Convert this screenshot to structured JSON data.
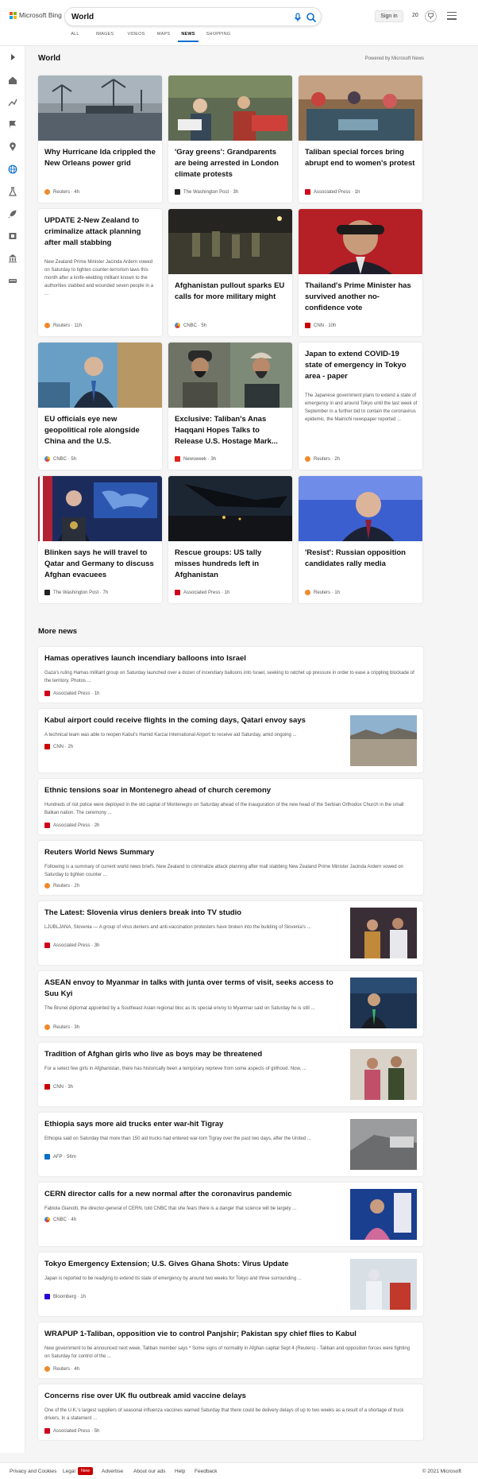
{
  "header": {
    "logo_text": "Microsoft Bing",
    "search_value": "World",
    "signin_label": "Sign in",
    "rewards_count": "20"
  },
  "tabs": [
    {
      "label": "ALL"
    },
    {
      "label": "IMAGES"
    },
    {
      "label": "VIDEOS"
    },
    {
      "label": "MAPS"
    },
    {
      "label": "NEWS"
    },
    {
      "label": "SHOPPING"
    }
  ],
  "page": {
    "title": "World",
    "powered_by": "Powered by Microsoft News",
    "more_news": "More news"
  },
  "cards": [
    {
      "title": "Why Hurricane Ida crippled the New Orleans power grid",
      "source": "Reuters",
      "age": "4h",
      "snippet": ""
    },
    {
      "title": "'Gray greens': Grandparents are being arrested in London climate protests",
      "source": "The Washington Post",
      "age": "3h",
      "snippet": ""
    },
    {
      "title": "Taliban special forces bring abrupt end to women's protest",
      "source": "Associated Press",
      "age": "1h",
      "snippet": ""
    },
    {
      "title": "UPDATE 2-New Zealand to criminalize attack planning after mall stabbing",
      "source": "Reuters",
      "age": "11h",
      "snippet": "New Zealand Prime Minister Jacinda Ardern vowed on Saturday to tighten counter-terrorism laws this month after a knife-wielding militant known to the authorities stabbed and wounded seven people in a ..."
    },
    {
      "title": "Afghanistan pullout sparks EU calls for more military might",
      "source": "CNBC",
      "age": "5h",
      "snippet": ""
    },
    {
      "title": "Thailand's Prime Minister has survived another no-confidence vote",
      "source": "CNN",
      "age": "10h",
      "snippet": ""
    },
    {
      "title": "EU officials eye new geopolitical role alongside China and the U.S.",
      "source": "CNBC",
      "age": "5h",
      "snippet": ""
    },
    {
      "title": "Exclusive: Taliban's Anas Haqqani Hopes Talks to Release U.S. Hostage Mark...",
      "source": "Newsweek",
      "age": "3h",
      "snippet": ""
    },
    {
      "title": "Japan to extend COVID-19 state of emergency in Tokyo area - paper",
      "source": "Reuters",
      "age": "2h",
      "snippet": "The Japanese government plans to extend a state of emergency in and around Tokyo until the last week of September in a further bid to contain the coronavirus epidemic, the Mainichi newspaper reported ..."
    },
    {
      "title": "Blinken says he will travel to Qatar and Germany to discuss Afghan evacuees",
      "source": "The Washington Post",
      "age": "7h",
      "snippet": ""
    },
    {
      "title": "Rescue groups: US tally misses hundreds left in Afghanistan",
      "source": "Associated Press",
      "age": "1h",
      "snippet": ""
    },
    {
      "title": "'Resist': Russian opposition candidates rally media",
      "source": "Reuters",
      "age": "1h",
      "snippet": ""
    }
  ],
  "more": [
    {
      "title": "Hamas operatives launch incendiary balloons into Israel",
      "snippet": "Gaza's ruling Hamas militant group on Saturday launched over a dozen of incendiary balloons into Israel, seeking to ratchet up pressure in order to ease a crippling blockade of the territory. Photos ...",
      "source": "Associated Press",
      "age": "1h"
    },
    {
      "title": "Kabul airport could receive flights in the coming days, Qatari envoy says",
      "snippet": "A technical team was able to reopen Kabul's Hamid Karzai International Airport to receive aid Saturday, amid ongoing ...",
      "source": "CNN",
      "age": "2h"
    },
    {
      "title": "Ethnic tensions soar in Montenegro ahead of church ceremony",
      "snippet": "Hundreds of riot police were deployed in the old capital of Montenegro on Saturday ahead of the inauguration of the new head of the Serbian Orthodox Church in the small Balkan nation. The ceremony ...",
      "source": "Associated Press",
      "age": "2h"
    },
    {
      "title": "Reuters World News Summary",
      "snippet": "Following is a summary of current world news briefs. New Zealand to criminalize attack planning after mall stabbing New Zealand Prime Minister Jacinda Ardern vowed on Saturday to tighten counter ...",
      "source": "Reuters",
      "age": "2h"
    },
    {
      "title": "The Latest: Slovenia virus deniers break into TV studio",
      "snippet": "LJUBLJANA, Slovenia — A group of virus deniers and anti-vaccination protesters have broken into the building of Slovenia's ...",
      "source": "Associated Press",
      "age": "3h"
    },
    {
      "title": "ASEAN envoy to Myanmar in talks with junta over terms of visit, seeks access to Suu Kyi",
      "snippet": "The Brunei diplomat appointed by a Southeast Asian regional bloc as its special envoy to Myanmar said on Saturday he is still ...",
      "source": "Reuters",
      "age": "3h"
    },
    {
      "title": "Tradition of Afghan girls who live as boys may be threatened",
      "snippet": "For a select few girls in Afghanistan, there has historically been a temporary reprieve from some aspects of girlhood. Now, ...",
      "source": "CNN",
      "age": "3h"
    },
    {
      "title": "Ethiopia says more aid trucks enter war-hit Tigray",
      "snippet": "Ethiopia said on Saturday that more than 150 aid trucks had entered war-torn Tigray over the past two days, after the United ...",
      "source": "AFP",
      "age": "56m"
    },
    {
      "title": "CERN director calls for a new normal after the coronavirus pandemic",
      "snippet": "Fabiola Gianotti, the director-general of CERN, told CNBC that she fears there is a danger that science will be largely ...",
      "source": "CNBC",
      "age": "4h"
    },
    {
      "title": "Tokyo Emergency Extension; U.S. Gives Ghana Shots: Virus Update",
      "snippet": "Japan is reported to be readying to extend its state of emergency by around two weeks for Tokyo and three surrounding ...",
      "source": "Bloomberg",
      "age": "1h"
    },
    {
      "title": "WRAPUP 1-Taliban, opposition vie to control Panjshir; Pakistan spy chief flies to Kabul",
      "snippet": "New government to be announced next week, Taliban member says * Some signs of normality in Afghan capital Sept 4 (Reuters) - Taliban and opposition forces were fighting on Saturday for control of the ...",
      "source": "Reuters",
      "age": "4h"
    },
    {
      "title": "Concerns rise over UK flu outbreak amid vaccine delays",
      "snippet": "One of the U.K.'s largest suppliers of seasonal influenza vaccines warned Saturday that there could be delivery delays of up to two weeks as a result of a shortage of truck drivers. In a statement ...",
      "source": "Associated Press",
      "age": "5h"
    }
  ],
  "footer": {
    "privacy": "Privacy and Cookies",
    "legal": "Legal",
    "new_badge": "New",
    "advertise": "Advertise",
    "about_ads": "About our ads",
    "help": "Help",
    "feedback": "Feedback",
    "copyright": "© 2021 Microsoft"
  },
  "colors": {
    "accent": "#0c6fd0",
    "new_badge": "#c80000"
  }
}
